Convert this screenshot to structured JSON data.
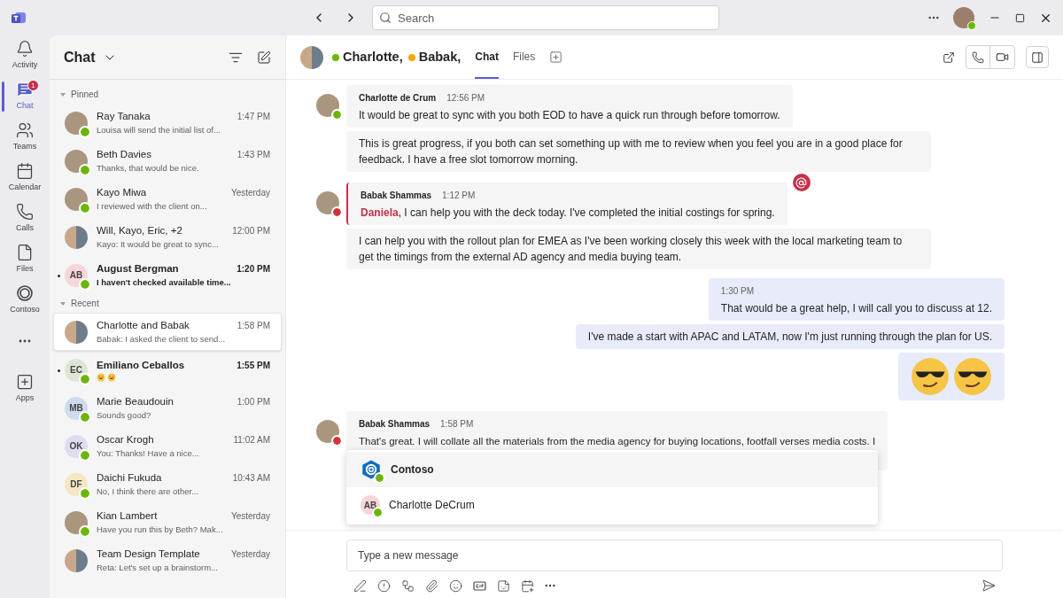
{
  "titlebar": {
    "search": {
      "placeholder": "Search"
    }
  },
  "rail": [
    {
      "kind": "bell",
      "label": "Activity",
      "selected": false
    },
    {
      "kind": "chat",
      "label": "Chat",
      "selected": true,
      "badge": "1"
    },
    {
      "kind": "teams",
      "label": "Teams",
      "selected": false
    },
    {
      "kind": "calendar",
      "label": "Calendar",
      "selected": false
    },
    {
      "kind": "calls",
      "label": "Calls",
      "selected": false
    },
    {
      "kind": "files",
      "label": "Files",
      "selected": false
    },
    {
      "kind": "rings",
      "label": "Contoso",
      "selected": false
    },
    {
      "kind": "more",
      "selected": false
    },
    {
      "kind": "apps",
      "label": "Apps",
      "selected": false
    }
  ],
  "chat_list": {
    "title": "Chat",
    "sections": [
      {
        "title": "Pinned",
        "expanded": true,
        "items": [
          {
            "name": "Ray Tanaka",
            "time": "1:47 PM",
            "preview": "Louisa will send the initial list of...",
            "avatar": {
              "kind": "photo"
            },
            "status": {
              "color": "#6bb700"
            },
            "unread": false,
            "selected": false
          },
          {
            "name": "Beth Davies",
            "time": "1:43 PM",
            "preview": "Thanks, that would be nice.",
            "avatar": {
              "kind": "photo"
            },
            "status": {
              "color": "#6bb700"
            },
            "unread": false,
            "selected": false
          },
          {
            "name": "Kayo Miwa",
            "time": "Yesterday",
            "preview": "I reviewed with the client on...",
            "avatar": {
              "kind": "photo"
            },
            "status": {
              "color": "#6bb700"
            },
            "unread": false,
            "selected": false
          },
          {
            "name": "Will, Kayo, Eric, +2",
            "time": "12:00 PM",
            "preview": "Kayo: It would be great to sync...",
            "avatar": {
              "kind": "group"
            },
            "unread": false,
            "selected": false
          },
          {
            "name": "August Bergman",
            "time": "1:20 PM",
            "preview": "I haven't checked available time...",
            "avatar": {
              "kind": "initials",
              "initials": "AB",
              "color": "#f6d6d8"
            },
            "status": {
              "color": "#6bb700"
            },
            "unread": true,
            "selected": false
          }
        ]
      },
      {
        "title": "Recent",
        "expanded": true,
        "items": [
          {
            "name": "Charlotte and Babak",
            "time": "1:58 PM",
            "preview": "Babak: I asked the client to send...",
            "avatar": {
              "kind": "group"
            },
            "unread": false,
            "selected": true
          },
          {
            "name": "Emiliano Ceballos",
            "time": "1:55 PM",
            "preview_icons": [
              {
                "kind": "laughing"
              },
              {
                "kind": "laughing"
              }
            ],
            "avatar": {
              "kind": "initials",
              "initials": "EC",
              "color": "#dde6d5"
            },
            "status": {
              "color": "#6bb700"
            },
            "unread": true,
            "selected": false
          },
          {
            "name": "Marie Beaudouin",
            "time": "1:00 PM",
            "preview": "Sounds good?",
            "avatar": {
              "kind": "initials",
              "initials": "MB",
              "color": "#cfdcef"
            },
            "status": {
              "color": "#6bb700"
            },
            "unread": false,
            "selected": false
          },
          {
            "name": "Oscar Krogh",
            "time": "11:02 AM",
            "preview": "You: Thanks! Have a nice...",
            "avatar": {
              "kind": "initials",
              "initials": "OK",
              "color": "#e0dcef"
            },
            "status": {
              "color": "#6bb700"
            },
            "unread": false,
            "selected": false
          },
          {
            "name": "Daichi Fukuda",
            "time": "10:43 AM",
            "preview": "No, I think there are other...",
            "avatar": {
              "kind": "initials",
              "initials": "DF",
              "color": "#f5e6c4"
            },
            "status": {
              "color": "#6bb700"
            },
            "unread": false,
            "selected": false
          },
          {
            "name": "Kian Lambert",
            "time": "Yesterday",
            "preview": "Have you run this by Beth? Mak...",
            "avatar": {
              "kind": "photo"
            },
            "status": {
              "color": "#6bb700"
            },
            "unread": false,
            "selected": false
          },
          {
            "name": "Team Design Template",
            "time": "Yesterday",
            "preview": "Reta: Let's set up a brainstorm...",
            "avatar": {
              "kind": "group"
            },
            "unread": false,
            "selected": false
          }
        ]
      }
    ]
  },
  "conversation": {
    "participants": [
      {
        "name": "Charlotte,",
        "status": {
          "color": "#6bb700"
        }
      },
      {
        "name": "Babak,",
        "status": {
          "color": "#f8a800"
        }
      }
    ],
    "tabs": [
      {
        "label": "Chat",
        "selected": true
      },
      {
        "label": "Files",
        "selected": false
      }
    ],
    "messages": [
      {
        "kind": "incoming",
        "sender": "Charlotte de Crum",
        "time": "12:56 PM",
        "status": {
          "color": "#6bb700"
        },
        "bubbles": [
          {
            "text": "It would be great to sync with you both EOD to have a quick run through before tomorrow."
          },
          {
            "text": "This is great progress, if you both can set something up with me to review when you feel you are in a good place for feedback. I have a free slot tomorrow morning."
          }
        ]
      },
      {
        "kind": "incoming",
        "sender": "Babak Shammas",
        "time": "1:12 PM",
        "status": {
          "color": "#d13438"
        },
        "bubbles": [
          {
            "mention": "Daniela",
            "text": ", I can help you with the deck today. I've completed the initial costings for spring.",
            "mentions_me": true
          },
          {
            "text": "I can help you with the rollout plan for EMEA as I've been working closely this week with the local marketing team to get the timings from the external AD agency and media buying team."
          }
        ]
      },
      {
        "kind": "outgoing",
        "time": "1:30 PM",
        "bubbles": [
          {
            "text": "That would be a great help, I will call you to discuss at 12."
          },
          {
            "text": "I've made a start with APAC and LATAM, now I'm just running through the plan for US."
          },
          {
            "emojis": [
              {
                "kind": "sunglasses"
              },
              {
                "kind": "sunglasses"
              }
            ]
          }
        ]
      },
      {
        "kind": "incoming",
        "sender": "Babak Shammas",
        "time": "1:58 PM",
        "status": {
          "color": "#d13438"
        },
        "bubbles": [
          {
            "text": "That's great. I will collate all the materials from the media agency for buying locations, footfall verses media costs. I"
          }
        ]
      }
    ],
    "suggestions": [
      {
        "label": "Contoso",
        "avatar": {
          "kind": "app"
        },
        "status": {
          "color": "#6bb700"
        },
        "selected": true
      },
      {
        "label": "Charlotte DeCrum",
        "avatar": {
          "kind": "initials",
          "initials": "AB",
          "color": "#f6d6d8"
        },
        "status": {
          "color": "#6bb700"
        },
        "selected": false
      }
    ],
    "compose": {
      "placeholder": "Type a new message"
    }
  }
}
